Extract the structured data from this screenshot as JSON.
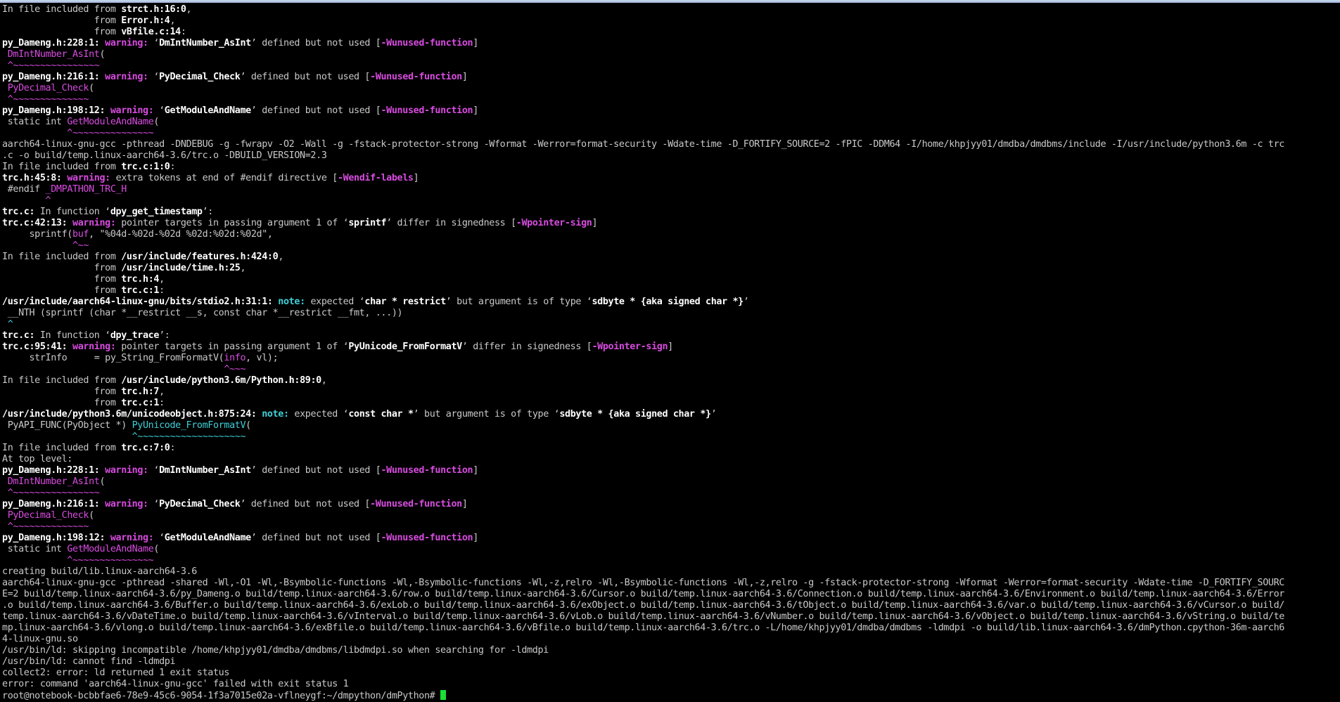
{
  "terminal": {
    "prompt": "root@notebook-bcbbfae6-78e9-45c6-9054-1f3a7015e02a-vflneygf:~/dmpython/dmPython# ",
    "lines": [
      [
        {
          "t": "In file included from "
        },
        {
          "t": "strct.h:16:0",
          "s": "b"
        },
        {
          "t": ","
        }
      ],
      [
        {
          "t": "                 from "
        },
        {
          "t": "Error.h:4",
          "s": "b"
        },
        {
          "t": ","
        }
      ],
      [
        {
          "t": "                 from "
        },
        {
          "t": "vBfile.c:14",
          "s": "b"
        },
        {
          "t": ":"
        }
      ],
      [
        {
          "t": "py_Dameng.h:228:1:",
          "s": "b"
        },
        {
          "t": " "
        },
        {
          "t": "warning:",
          "s": "mb"
        },
        {
          "t": " ‘"
        },
        {
          "t": "DmIntNumber_AsInt",
          "s": "b"
        },
        {
          "t": "’ defined but not used ["
        },
        {
          "t": "-Wunused-function",
          "s": "mb"
        },
        {
          "t": "]"
        }
      ],
      [
        {
          "t": " "
        },
        {
          "t": "DmIntNumber_AsInt",
          "s": "m"
        },
        {
          "t": "("
        }
      ],
      [
        {
          "t": " ^~~~~~~~~~~~~~~~~",
          "s": "m"
        }
      ],
      [
        {
          "t": "py_Dameng.h:216:1:",
          "s": "b"
        },
        {
          "t": " "
        },
        {
          "t": "warning:",
          "s": "mb"
        },
        {
          "t": " ‘"
        },
        {
          "t": "PyDecimal_Check",
          "s": "b"
        },
        {
          "t": "’ defined but not used ["
        },
        {
          "t": "-Wunused-function",
          "s": "mb"
        },
        {
          "t": "]"
        }
      ],
      [
        {
          "t": " "
        },
        {
          "t": "PyDecimal_Check",
          "s": "m"
        },
        {
          "t": "("
        }
      ],
      [
        {
          "t": " ^~~~~~~~~~~~~~~",
          "s": "m"
        }
      ],
      [
        {
          "t": "py_Dameng.h:198:12:",
          "s": "b"
        },
        {
          "t": " "
        },
        {
          "t": "warning:",
          "s": "mb"
        },
        {
          "t": " ‘"
        },
        {
          "t": "GetModuleAndName",
          "s": "b"
        },
        {
          "t": "’ defined but not used ["
        },
        {
          "t": "-Wunused-function",
          "s": "mb"
        },
        {
          "t": "]"
        }
      ],
      [
        {
          "t": " static int "
        },
        {
          "t": "GetModuleAndName",
          "s": "m"
        },
        {
          "t": "("
        }
      ],
      [
        {
          "t": "            ^~~~~~~~~~~~~~~~",
          "s": "m"
        }
      ],
      [
        {
          "t": "aarch64-linux-gnu-gcc -pthread -DNDEBUG -g -fwrapv -O2 -Wall -g -fstack-protector-strong -Wformat -Werror=format-security -Wdate-time -D_FORTIFY_SOURCE=2 -fPIC -DDM64 -I/home/khpjyy01/dmdba/dmdbms/include -I/usr/include/python3.6m -c trc"
        }
      ],
      [
        {
          "t": ".c -o build/temp.linux-aarch64-3.6/trc.o -DBUILD_VERSION=2.3"
        }
      ],
      [
        {
          "t": "In file included from "
        },
        {
          "t": "trc.c:1:0",
          "s": "b"
        },
        {
          "t": ":"
        }
      ],
      [
        {
          "t": "trc.h:45:8:",
          "s": "b"
        },
        {
          "t": " "
        },
        {
          "t": "warning:",
          "s": "mb"
        },
        {
          "t": " extra tokens at end of #endif directive ["
        },
        {
          "t": "-Wendif-labels",
          "s": "mb"
        },
        {
          "t": "]"
        }
      ],
      [
        {
          "t": " #endif "
        },
        {
          "t": "_DMPATHON_TRC_H",
          "s": "m"
        }
      ],
      [
        {
          "t": "        ^",
          "s": "m"
        }
      ],
      [
        {
          "t": "trc.c:",
          "s": "b"
        },
        {
          "t": " In function ‘"
        },
        {
          "t": "dpy_get_timestamp",
          "s": "b"
        },
        {
          "t": "’:"
        }
      ],
      [
        {
          "t": "trc.c:42:13:",
          "s": "b"
        },
        {
          "t": " "
        },
        {
          "t": "warning:",
          "s": "mb"
        },
        {
          "t": " pointer targets in passing argument 1 of ‘"
        },
        {
          "t": "sprintf",
          "s": "b"
        },
        {
          "t": "’ differ in signedness ["
        },
        {
          "t": "-Wpointer-sign",
          "s": "mb"
        },
        {
          "t": "]"
        }
      ],
      [
        {
          "t": "     sprintf("
        },
        {
          "t": "buf",
          "s": "m"
        },
        {
          "t": ", \"%04d-%02d-%02d %02d:%02d:%02d\","
        }
      ],
      [
        {
          "t": "             ^~~",
          "s": "m"
        }
      ],
      [
        {
          "t": "In file included from "
        },
        {
          "t": "/usr/include/features.h:424:0",
          "s": "b"
        },
        {
          "t": ","
        }
      ],
      [
        {
          "t": "                 from "
        },
        {
          "t": "/usr/include/time.h:25",
          "s": "b"
        },
        {
          "t": ","
        }
      ],
      [
        {
          "t": "                 from "
        },
        {
          "t": "trc.h:4",
          "s": "b"
        },
        {
          "t": ","
        }
      ],
      [
        {
          "t": "                 from "
        },
        {
          "t": "trc.c:1",
          "s": "b"
        },
        {
          "t": ":"
        }
      ],
      [
        {
          "t": "/usr/include/aarch64-linux-gnu/bits/stdio2.h:31:1:",
          "s": "b"
        },
        {
          "t": " "
        },
        {
          "t": "note:",
          "s": "cb"
        },
        {
          "t": " expected ‘"
        },
        {
          "t": "char * restrict",
          "s": "b"
        },
        {
          "t": "’ but argument is of type ‘"
        },
        {
          "t": "sdbyte * {aka signed char *}",
          "s": "b"
        },
        {
          "t": "’"
        }
      ],
      [
        {
          "t": " __NTH (sprintf (char *__restrict __s, const char *__restrict __fmt, ...))"
        }
      ],
      [
        {
          "t": " ^",
          "s": "c"
        }
      ],
      [
        {
          "t": "trc.c:",
          "s": "b"
        },
        {
          "t": " In function ‘"
        },
        {
          "t": "dpy_trace",
          "s": "b"
        },
        {
          "t": "’:"
        }
      ],
      [
        {
          "t": "trc.c:95:41:",
          "s": "b"
        },
        {
          "t": " "
        },
        {
          "t": "warning:",
          "s": "mb"
        },
        {
          "t": " pointer targets in passing argument 1 of ‘"
        },
        {
          "t": "PyUnicode_FromFormatV",
          "s": "b"
        },
        {
          "t": "’ differ in signedness ["
        },
        {
          "t": "-Wpointer-sign",
          "s": "mb"
        },
        {
          "t": "]"
        }
      ],
      [
        {
          "t": "     strInfo     = py_String_FromFormatV("
        },
        {
          "t": "info",
          "s": "m"
        },
        {
          "t": ", vl);"
        }
      ],
      [
        {
          "t": "                                         ^~~~",
          "s": "m"
        }
      ],
      [
        {
          "t": "In file included from "
        },
        {
          "t": "/usr/include/python3.6m/Python.h:89:0",
          "s": "b"
        },
        {
          "t": ","
        }
      ],
      [
        {
          "t": "                 from "
        },
        {
          "t": "trc.h:7",
          "s": "b"
        },
        {
          "t": ","
        }
      ],
      [
        {
          "t": "                 from "
        },
        {
          "t": "trc.c:1",
          "s": "b"
        },
        {
          "t": ":"
        }
      ],
      [
        {
          "t": "/usr/include/python3.6m/unicodeobject.h:875:24:",
          "s": "b"
        },
        {
          "t": " "
        },
        {
          "t": "note:",
          "s": "cb"
        },
        {
          "t": " expected ‘"
        },
        {
          "t": "const char *",
          "s": "b"
        },
        {
          "t": "’ but argument is of type ‘"
        },
        {
          "t": "sdbyte * {aka signed char *}",
          "s": "b"
        },
        {
          "t": "’"
        }
      ],
      [
        {
          "t": " PyAPI_FUNC(PyObject *) "
        },
        {
          "t": "PyUnicode_FromFormatV",
          "s": "c"
        },
        {
          "t": "("
        }
      ],
      [
        {
          "t": "                        ^~~~~~~~~~~~~~~~~~~~~",
          "s": "c"
        }
      ],
      [
        {
          "t": "In file included from "
        },
        {
          "t": "trc.c:7:0",
          "s": "b"
        },
        {
          "t": ":"
        }
      ],
      [
        {
          "t": "At top level:"
        }
      ],
      [
        {
          "t": "py_Dameng.h:228:1:",
          "s": "b"
        },
        {
          "t": " "
        },
        {
          "t": "warning:",
          "s": "mb"
        },
        {
          "t": " ‘"
        },
        {
          "t": "DmIntNumber_AsInt",
          "s": "b"
        },
        {
          "t": "’ defined but not used ["
        },
        {
          "t": "-Wunused-function",
          "s": "mb"
        },
        {
          "t": "]"
        }
      ],
      [
        {
          "t": " "
        },
        {
          "t": "DmIntNumber_AsInt",
          "s": "m"
        },
        {
          "t": "("
        }
      ],
      [
        {
          "t": " ^~~~~~~~~~~~~~~~~",
          "s": "m"
        }
      ],
      [
        {
          "t": "py_Dameng.h:216:1:",
          "s": "b"
        },
        {
          "t": " "
        },
        {
          "t": "warning:",
          "s": "mb"
        },
        {
          "t": " ‘"
        },
        {
          "t": "PyDecimal_Check",
          "s": "b"
        },
        {
          "t": "’ defined but not used ["
        },
        {
          "t": "-Wunused-function",
          "s": "mb"
        },
        {
          "t": "]"
        }
      ],
      [
        {
          "t": " "
        },
        {
          "t": "PyDecimal_Check",
          "s": "m"
        },
        {
          "t": "("
        }
      ],
      [
        {
          "t": " ^~~~~~~~~~~~~~~",
          "s": "m"
        }
      ],
      [
        {
          "t": "py_Dameng.h:198:12:",
          "s": "b"
        },
        {
          "t": " "
        },
        {
          "t": "warning:",
          "s": "mb"
        },
        {
          "t": " ‘"
        },
        {
          "t": "GetModuleAndName",
          "s": "b"
        },
        {
          "t": "’ defined but not used ["
        },
        {
          "t": "-Wunused-function",
          "s": "mb"
        },
        {
          "t": "]"
        }
      ],
      [
        {
          "t": " static int "
        },
        {
          "t": "GetModuleAndName",
          "s": "m"
        },
        {
          "t": "("
        }
      ],
      [
        {
          "t": "            ^~~~~~~~~~~~~~~~",
          "s": "m"
        }
      ],
      [
        {
          "t": "creating build/lib.linux-aarch64-3.6"
        }
      ],
      [
        {
          "t": "aarch64-linux-gnu-gcc -pthread -shared -Wl,-O1 -Wl,-Bsymbolic-functions -Wl,-Bsymbolic-functions -Wl,-z,relro -Wl,-Bsymbolic-functions -Wl,-z,relro -g -fstack-protector-strong -Wformat -Werror=format-security -Wdate-time -D_FORTIFY_SOURC"
        }
      ],
      [
        {
          "t": "E=2 build/temp.linux-aarch64-3.6/py_Dameng.o build/temp.linux-aarch64-3.6/row.o build/temp.linux-aarch64-3.6/Cursor.o build/temp.linux-aarch64-3.6/Connection.o build/temp.linux-aarch64-3.6/Environment.o build/temp.linux-aarch64-3.6/Error"
        }
      ],
      [
        {
          "t": ".o build/temp.linux-aarch64-3.6/Buffer.o build/temp.linux-aarch64-3.6/exLob.o build/temp.linux-aarch64-3.6/exObject.o build/temp.linux-aarch64-3.6/tObject.o build/temp.linux-aarch64-3.6/var.o build/temp.linux-aarch64-3.6/vCursor.o build/"
        }
      ],
      [
        {
          "t": "temp.linux-aarch64-3.6/vDateTime.o build/temp.linux-aarch64-3.6/vInterval.o build/temp.linux-aarch64-3.6/vLob.o build/temp.linux-aarch64-3.6/vNumber.o build/temp.linux-aarch64-3.6/vObject.o build/temp.linux-aarch64-3.6/vString.o build/te"
        }
      ],
      [
        {
          "t": "mp.linux-aarch64-3.6/vlong.o build/temp.linux-aarch64-3.6/exBfile.o build/temp.linux-aarch64-3.6/vBfile.o build/temp.linux-aarch64-3.6/trc.o -L/home/khpjyy01/dmdba/dmdbms -ldmdpi -o build/lib.linux-aarch64-3.6/dmPython.cpython-36m-aarch6"
        }
      ],
      [
        {
          "t": "4-linux-gnu.so"
        }
      ],
      [
        {
          "t": "/usr/bin/ld: skipping incompatible /home/khpjyy01/dmdba/dmdbms/libdmdpi.so when searching for -ldmdpi"
        }
      ],
      [
        {
          "t": "/usr/bin/ld: cannot find -ldmdpi"
        }
      ],
      [
        {
          "t": "collect2: error: ld returned 1 exit status"
        }
      ],
      [
        {
          "t": "error: command 'aarch64-linux-gnu-gcc' failed with exit status 1"
        }
      ]
    ]
  }
}
